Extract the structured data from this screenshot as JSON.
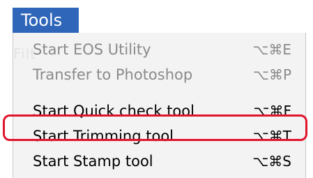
{
  "menu_title": "Tools",
  "background_label": "Filt",
  "items": [
    {
      "label": "Start EOS Utility",
      "shortcut": "⌥⌘E",
      "enabled": false
    },
    {
      "label": "Transfer to Photoshop",
      "shortcut": "⌥⌘P",
      "enabled": false
    },
    {
      "label": "Start Quick check tool",
      "shortcut": "⌥⌘F",
      "enabled": true
    },
    {
      "label": "Start Trimming tool",
      "shortcut": "⌥⌘T",
      "enabled": true,
      "highlighted": true
    },
    {
      "label": "Start Stamp tool",
      "shortcut": "⌥⌘S",
      "enabled": true
    }
  ],
  "colors": {
    "menu_title_bg": "#2f66ba",
    "highlight_border": "#e0142b",
    "disabled_text": "#8a8a8a"
  }
}
